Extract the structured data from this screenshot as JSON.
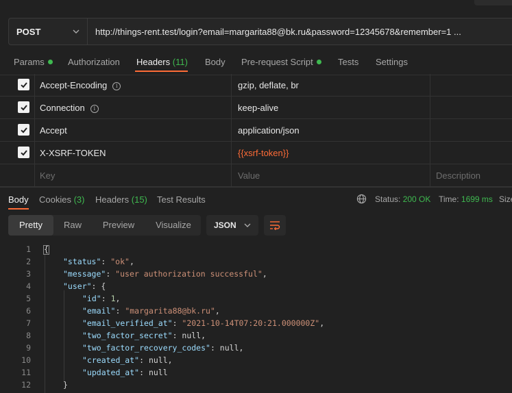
{
  "request": {
    "method": "POST",
    "url": "http://things-rent.test/login?email=margarita88@bk.ru&password=12345678&remember=1 ..."
  },
  "request_tabs": [
    {
      "label": "Params",
      "dot": true
    },
    {
      "label": "Authorization"
    },
    {
      "label": "Headers",
      "count": "(11)",
      "active": true
    },
    {
      "label": "Body"
    },
    {
      "label": "Pre-request Script",
      "dot": true
    },
    {
      "label": "Tests"
    },
    {
      "label": "Settings"
    }
  ],
  "headers": [
    {
      "key": "Accept-Encoding",
      "value": "gzip, deflate, br",
      "checked": true,
      "info": true
    },
    {
      "key": "Connection",
      "value": "keep-alive",
      "checked": true,
      "info": true
    },
    {
      "key": "Accept",
      "value": "application/json",
      "checked": true,
      "info": false
    },
    {
      "key": "X-XSRF-TOKEN",
      "value": "{{xsrf-token}}",
      "checked": true,
      "info": false,
      "variable": true
    }
  ],
  "headers_placeholders": {
    "key": "Key",
    "value": "Value",
    "description": "Description"
  },
  "response_tabs": [
    {
      "label": "Body",
      "active": true
    },
    {
      "label": "Cookies",
      "count": "(3)"
    },
    {
      "label": "Headers",
      "count": "(15)"
    },
    {
      "label": "Test Results"
    }
  ],
  "response_status": {
    "status_label": "Status:",
    "status_value": "200 OK",
    "time_label": "Time:",
    "time_value": "1699 ms",
    "size_label": "Size"
  },
  "view_modes": [
    "Pretty",
    "Raw",
    "Preview",
    "Visualize"
  ],
  "active_view": "Pretty",
  "format": "JSON",
  "code_lines": [
    "1",
    "2",
    "3",
    "4",
    "5",
    "6",
    "7",
    "8",
    "9",
    "10",
    "11",
    "12"
  ],
  "json_body": {
    "status_key": "\"status\"",
    "status_val": "\"ok\"",
    "message_key": "\"message\"",
    "message_val": "\"user authorization successful\"",
    "user_key": "\"user\"",
    "id_key": "\"id\"",
    "id_val": "1",
    "email_key": "\"email\"",
    "email_val": "\"margarita88@bk.ru\"",
    "verified_key": "\"email_verified_at\"",
    "verified_val": "\"2021-10-14T07:20:21.000000Z\"",
    "tfs_key": "\"two_factor_secret\"",
    "tfs_val": "null",
    "tfr_key": "\"two_factor_recovery_codes\"",
    "tfr_val": "null",
    "created_key": "\"created_at\"",
    "created_val": "null",
    "updated_key": "\"updated_at\"",
    "updated_val": "null"
  },
  "colors": {
    "accent": "#ff6c37",
    "ok": "#3fb950",
    "background": "#212121"
  }
}
